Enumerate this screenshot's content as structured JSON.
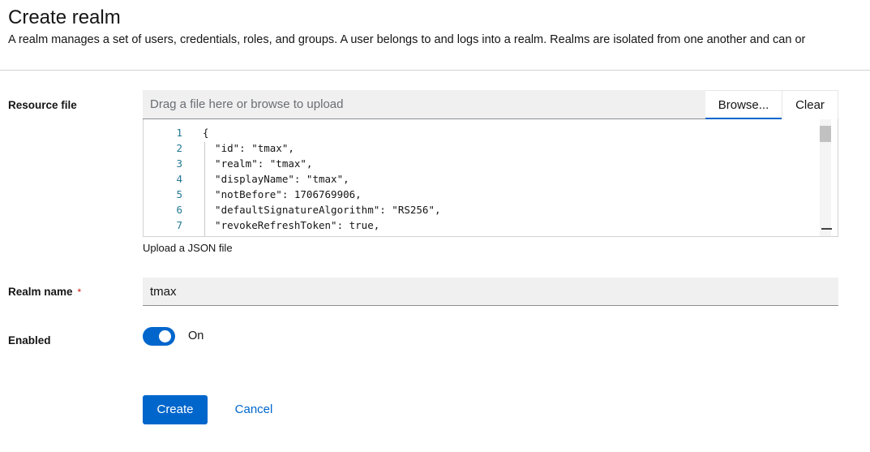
{
  "header": {
    "title": "Create realm",
    "description": "A realm manages a set of users, credentials, roles, and groups. A user belongs to and logs into a realm. Realms are isolated from one another and can or"
  },
  "resource_file": {
    "label": "Resource file",
    "placeholder": "Drag a file here or browse to upload",
    "browse_label": "Browse...",
    "clear_label": "Clear",
    "helper": "Upload a JSON file",
    "lines": [
      {
        "num": "1",
        "text": "{"
      },
      {
        "num": "2",
        "text": "  \"id\": \"tmax\","
      },
      {
        "num": "3",
        "text": "  \"realm\": \"tmax\","
      },
      {
        "num": "4",
        "text": "  \"displayName\": \"tmax\","
      },
      {
        "num": "5",
        "text": "  \"notBefore\": 1706769906,"
      },
      {
        "num": "6",
        "text": "  \"defaultSignatureAlgorithm\": \"RS256\","
      },
      {
        "num": "7",
        "text": "  \"revokeRefreshToken\": true,"
      }
    ]
  },
  "realm_name": {
    "label": "Realm name",
    "required_mark": "*",
    "value": "tmax"
  },
  "enabled": {
    "label": "Enabled",
    "state_label": "On",
    "checked": true
  },
  "actions": {
    "create_label": "Create",
    "cancel_label": "Cancel"
  },
  "colors": {
    "primary": "#0066cc",
    "required": "#c9190b",
    "line_number": "#237893"
  }
}
